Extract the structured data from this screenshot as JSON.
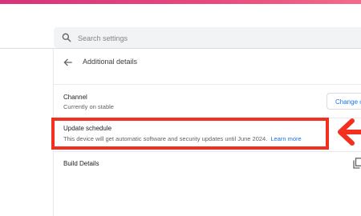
{
  "search": {
    "placeholder": "Search settings"
  },
  "page": {
    "title": "Additional details"
  },
  "channel": {
    "title": "Channel",
    "subtitle": "Currently on stable",
    "button_label": "Change c"
  },
  "update_schedule": {
    "title": "Update schedule",
    "description": "This device will get automatic software and security updates until June 2024.",
    "link": "Learn more"
  },
  "build": {
    "title": "Build Details"
  },
  "colors": {
    "accent": "#1a73e8",
    "highlight": "#f32f20",
    "top_bar": "#e84a7f"
  },
  "icons": [
    "search-icon",
    "back-arrow-icon",
    "copy-icon",
    "red-pointer-arrow"
  ]
}
